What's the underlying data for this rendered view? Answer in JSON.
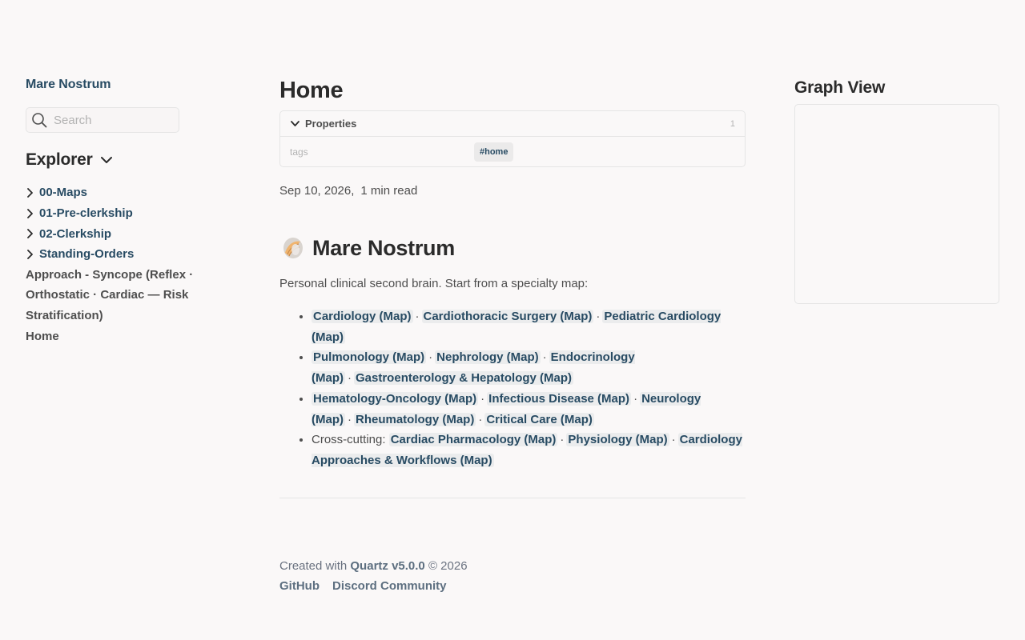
{
  "site": {
    "title": "Mare Nostrum",
    "search_placeholder": "Search",
    "icons": [
      "search-icon",
      "chevron-down-icon",
      "chevron-right-icon",
      "shell-icon"
    ]
  },
  "explorer": {
    "title": "Explorer",
    "folders": [
      "00-Maps",
      "01-Pre-clerkship",
      "02-Clerkship",
      "Standing-Orders"
    ],
    "files": [
      "Approach - Syncope (Reflex · Orthostatic · Cardiac — Risk Stratification)",
      "Home"
    ]
  },
  "page": {
    "title": "Home",
    "properties": {
      "label": "Properties",
      "count": "1",
      "key": "tags",
      "tag": "#home"
    },
    "date": "Sep 10, 2026,",
    "read_time": "1 min read",
    "heading": "Mare Nostrum",
    "intro": "Personal clinical second brain. Start from a specialty map:",
    "list": {
      "item1": [
        "Cardiology (Map)",
        "Cardiothoracic Surgery (Map)",
        "Pediatric Cardiology (Map)"
      ],
      "item2": [
        "Pulmonology (Map)",
        "Nephrology (Map)",
        "Endocrinology (Map)",
        "Gastroenterology & Hepatology (Map)"
      ],
      "item3": [
        "Hematology-Oncology (Map)",
        "Infectious Disease (Map)",
        "Neurology (Map)",
        "Rheumatology (Map)",
        "Critical Care (Map)"
      ],
      "item4_prefix": "Cross-cutting:",
      "item4": [
        "Cardiac Pharmacology (Map)",
        "Physiology (Map)",
        "Cardiology Approaches & Workflows (Map)"
      ]
    },
    "separator": "·"
  },
  "footer": {
    "created_prefix": "Created with",
    "quartz_link": "Quartz v5.0.0",
    "copyright": "© 2026",
    "github": "GitHub",
    "discord": "Discord Community"
  },
  "graph": {
    "title": "Graph View"
  },
  "colors": {
    "background": "#faf8f8",
    "link": "#284b63",
    "link_bg": "#ebeced",
    "text": "#2b2b2b",
    "muted": "#4e4e4e",
    "border": "#e5e5e5"
  }
}
